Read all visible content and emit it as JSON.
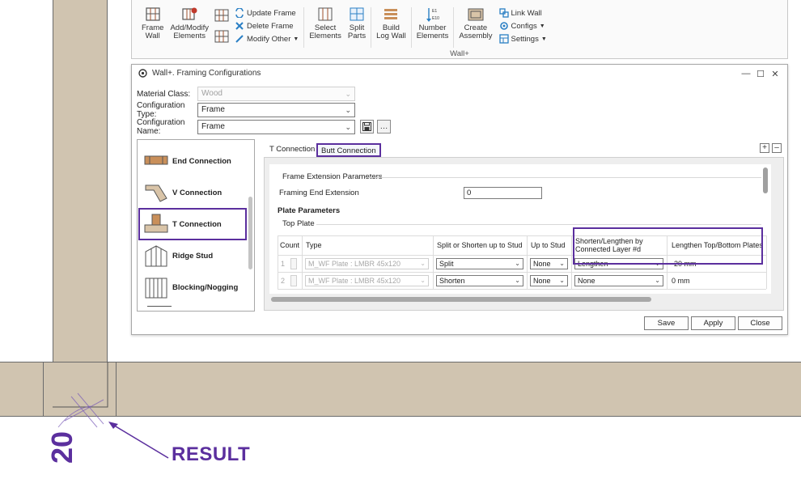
{
  "ribbon": {
    "group_label": "Wall+",
    "buttons": [
      {
        "label1": "Frame",
        "label2": "Wall",
        "icon": "frame-wall-icon"
      },
      {
        "label1": "Add/Modify",
        "label2": "Elements",
        "icon": "add-modify-elements-icon"
      },
      {
        "label1": "Select",
        "label2": "Elements",
        "icon": "select-elements-icon"
      },
      {
        "label1": "Split",
        "label2": "Parts",
        "icon": "split-parts-icon"
      },
      {
        "label1": "Build",
        "label2": "Log Wall",
        "icon": "build-log-wall-icon"
      },
      {
        "label1": "Number",
        "label2": "Elements",
        "icon": "number-elements-icon"
      },
      {
        "label1": "Create",
        "label2": "Assembly",
        "icon": "create-assembly-icon"
      }
    ],
    "small_left": [
      {
        "label": "Update Frame",
        "icon": "update-frame-icon"
      },
      {
        "label": "Delete Frame",
        "icon": "delete-frame-icon"
      },
      {
        "label": "Modify Other",
        "icon": "modify-other-icon"
      }
    ],
    "small_right": [
      {
        "label": "Link Wall",
        "icon": "link-wall-icon"
      },
      {
        "label": "Configs",
        "icon": "configs-icon"
      },
      {
        "label": "Settings",
        "icon": "settings-icon"
      }
    ]
  },
  "dialog": {
    "title": "Wall+. Framing Configurations",
    "material_class": {
      "label": "Material Class:",
      "value": "Wood"
    },
    "config_type": {
      "label": "Configuration Type:",
      "value": "Frame"
    },
    "config_name": {
      "label": "Configuration Name:",
      "value": "Frame"
    },
    "list_items": [
      "End Connection",
      "V Connection",
      "T Connection",
      "Ridge Stud",
      "Blocking/Nogging"
    ],
    "tabs": [
      "T Connection",
      "Butt Connection"
    ],
    "frame_ext": {
      "title": "Frame Extension Parameters",
      "label": "Framing End Extension",
      "value": "0"
    },
    "plate_params": {
      "title": "Plate Parameters",
      "subtitle": "Top Plate"
    },
    "table": {
      "headers": [
        "Count",
        "Type",
        "Split or Shorten up to Stud",
        "Up to Stud",
        "Shorten/Lengthen by Connected Layer #d",
        "Lengthen Top/Bottom Plates"
      ],
      "rows": [
        {
          "count": "1",
          "type": "M_WF Plate : LMBR 45x120",
          "split": "Split",
          "upto": "None",
          "shorten": "Lengthen",
          "lengthen": "-20 mm"
        },
        {
          "count": "2",
          "type": "M_WF Plate : LMBR 45x120",
          "split": "Shorten",
          "upto": "None",
          "shorten": "None",
          "lengthen": "0 mm"
        }
      ]
    },
    "buttons": {
      "save": "Save",
      "apply": "Apply",
      "close": "Close"
    }
  },
  "annotation": {
    "dimension": "20",
    "result": "RESULT"
  },
  "colors": {
    "accent": "#5b2f9e",
    "wall_fill": "#d0c4b0"
  }
}
